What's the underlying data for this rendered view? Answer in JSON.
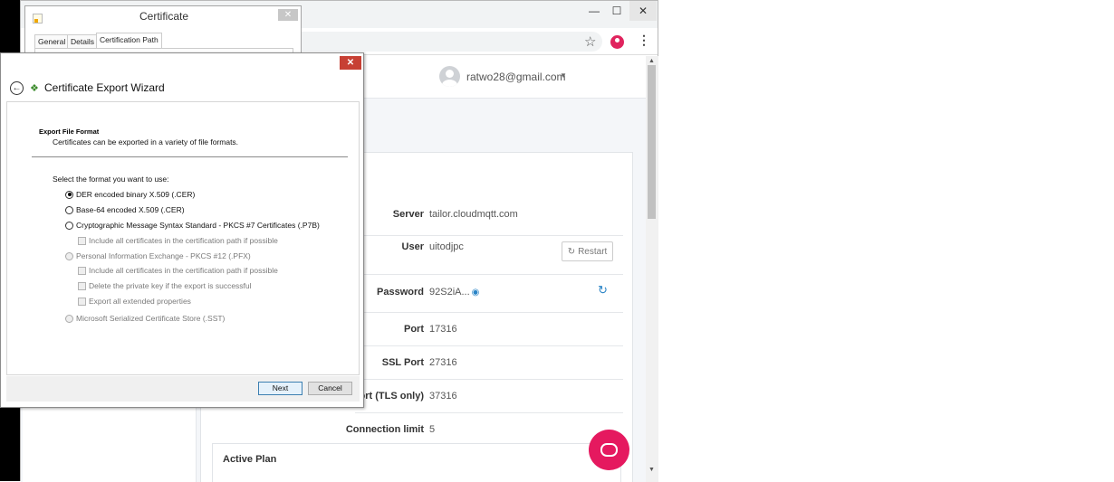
{
  "browser": {
    "window_controls": {
      "minimize": "—",
      "maximize": "☐",
      "close": "✕"
    },
    "star_icon": "☆",
    "menu_icon": "⋮",
    "user": {
      "email": "ratwo28@gmail.com",
      "caret": "▼"
    },
    "details": [
      {
        "label": "Server",
        "value": "tailor.cloudmqtt.com"
      },
      {
        "label": "User",
        "value": "uitodjpc"
      },
      {
        "label": "Password",
        "value": "92S2iA..."
      },
      {
        "label": "Port",
        "value": "17316"
      },
      {
        "label": "SSL Port",
        "value": "27316"
      },
      {
        "label": "s Port (TLS only)",
        "value": "37316"
      },
      {
        "label": "Connection limit",
        "value": "5"
      }
    ],
    "restart_label": "Restart",
    "active_plan_title": "Active Plan",
    "colors": {
      "accent": "#e5195f",
      "link": "#2a84c6"
    }
  },
  "certificate": {
    "title": "Certificate",
    "tabs": [
      "General",
      "Details",
      "Certification Path"
    ],
    "active_tab": "Certification Path",
    "close": "✕"
  },
  "wizard": {
    "title": "Certificate Export Wizard",
    "close": "✕",
    "back": "←",
    "heading": "Export File Format",
    "subheading": "Certificates can be exported in a variety of file formats.",
    "prompt": "Select the format you want to use:",
    "options": [
      {
        "label": "DER encoded binary X.509 (.CER)",
        "selected": true,
        "enabled": true
      },
      {
        "label": "Base-64 encoded X.509 (.CER)",
        "selected": false,
        "enabled": true
      },
      {
        "label": "Cryptographic Message Syntax Standard - PKCS #7 Certificates (.P7B)",
        "selected": false,
        "enabled": true
      },
      {
        "label": "Personal Information Exchange - PKCS #12 (.PFX)",
        "selected": false,
        "enabled": false
      },
      {
        "label": "Microsoft Serialized Certificate Store (.SST)",
        "selected": false,
        "enabled": false
      }
    ],
    "checkboxes": [
      "Include all certificates in the certification path if possible",
      "Include all certificates in the certification path if possible",
      "Delete the private key if the export is successful",
      "Export all extended properties"
    ],
    "next_label": "Next",
    "cancel_label": "Cancel"
  }
}
